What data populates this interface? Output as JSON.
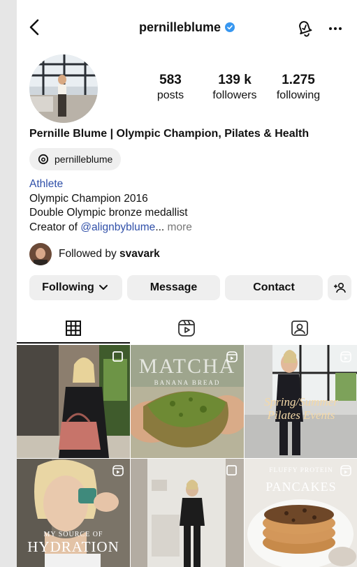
{
  "header": {
    "username": "pernilleblume"
  },
  "stats": [
    {
      "value": "583",
      "label": "posts"
    },
    {
      "value": "139 k",
      "label": "followers"
    },
    {
      "value": "1.275",
      "label": "following"
    }
  ],
  "profile": {
    "display_name": "Pernille Blume | Olympic Champion, Pilates & Health",
    "threads_handle": "pernilleblume",
    "category": "Athlete",
    "bio_line1": "Olympic Champion 2016",
    "bio_line2": "Double Olympic bronze medallist",
    "bio_line3_prefix": "Creator of ",
    "bio_mention": "@alignbyblume",
    "bio_ellipsis": "...",
    "bio_more": " more"
  },
  "followed_by": {
    "prefix": "Followed by ",
    "user": "svavark"
  },
  "buttons": {
    "following": "Following",
    "message": "Message",
    "contact": "Contact"
  },
  "posts": {
    "matcha_title": "MATCHA",
    "matcha_subtitle": "BANANA BREAD",
    "pilates_line1": "Spring/Summer",
    "pilates_line2": "Pilates Events",
    "hydration_line1": "MY SOURCE OF",
    "hydration_line2": "HYDRATION",
    "pancake_line1": "FLUFFY PROTEIN",
    "pancake_line2": "PANCAKES"
  },
  "colors": {
    "link": "#2f4fa8",
    "verified": "#3897f0",
    "button_bg": "#efefef"
  }
}
